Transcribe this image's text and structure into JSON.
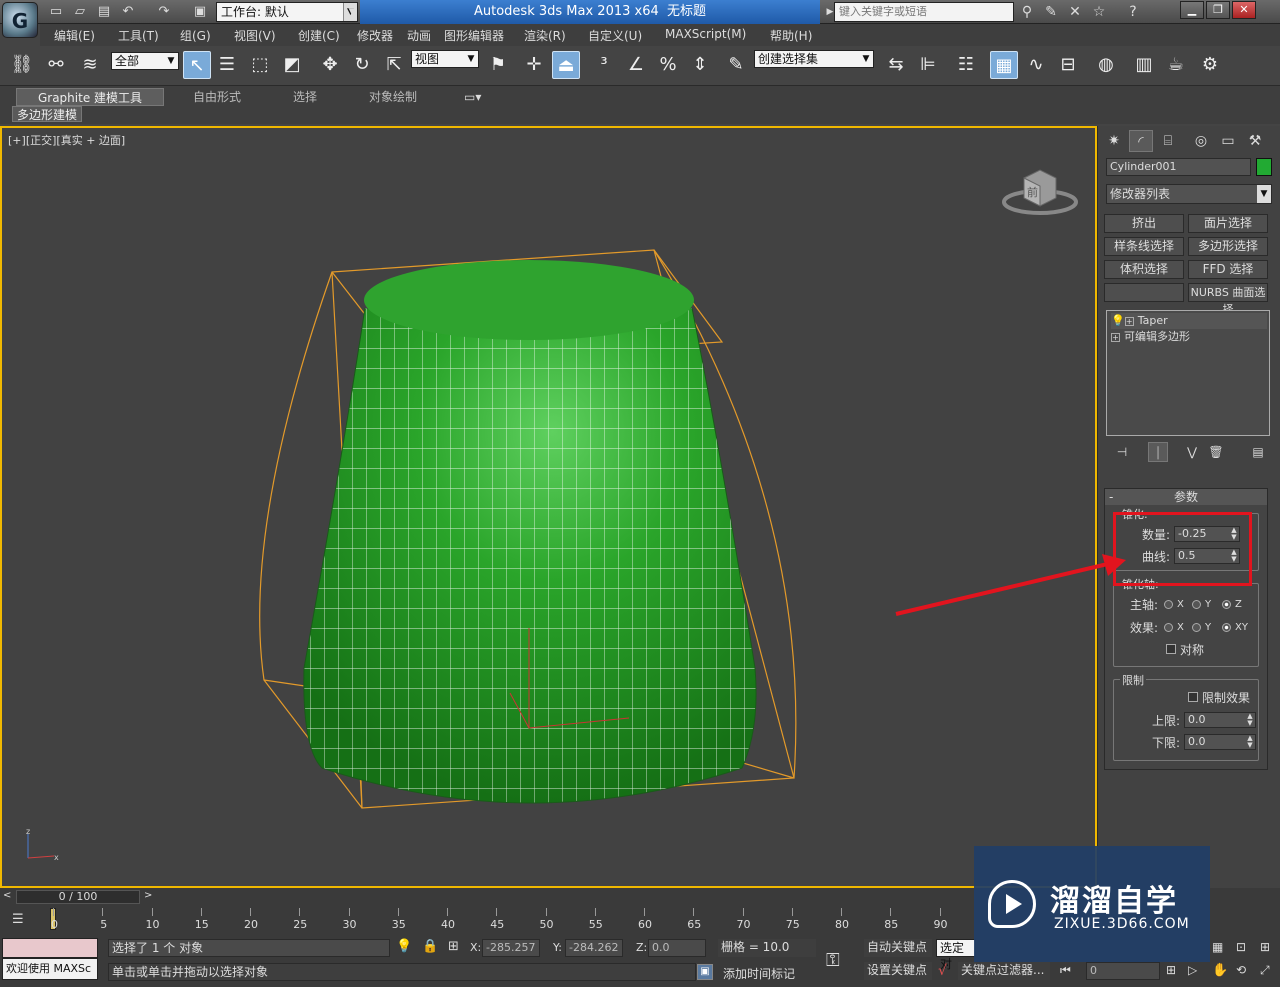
{
  "titlebar": {
    "workspace": "工作台: 默认",
    "app_name": "Autodesk 3ds Max  2013 x64",
    "doc_name": "无标题",
    "search_placeholder": "键入关键字或短语",
    "logo_letter": "G"
  },
  "menu": [
    "编辑(E)",
    "工具(T)",
    "组(G)",
    "视图(V)",
    "创建(C)",
    "修改器",
    "动画",
    "图形编辑器",
    "渲染(R)",
    "自定义(U)",
    "MAXScript(M)",
    "帮助(H)"
  ],
  "toolbar": {
    "selection_filter": "全部",
    "ref_coord": "视图",
    "named_selection": "创建选择集"
  },
  "ribbon": {
    "tabs": [
      "Graphite 建模工具",
      "自由形式",
      "选择",
      "对象绘制"
    ],
    "subtab": "多边形建模"
  },
  "viewport": {
    "label_parts": [
      "[+]",
      "[正交]",
      "[真实 + 边面]"
    ],
    "viewcube_face": "前"
  },
  "command_panel": {
    "object_name": "Cylinder001",
    "object_color": "#22aa33",
    "modifier_list": "修改器列表",
    "modifier_buttons": [
      "挤出",
      "面片选择",
      "样条线选择",
      "多边形选择",
      "体积选择",
      "FFD 选择",
      "",
      "NURBS 曲面选择"
    ],
    "stack": [
      "Taper",
      "可编辑多边形"
    ],
    "rollout_title": "参数",
    "taper": {
      "group_label": "锥化:",
      "amount_label": "数量:",
      "amount_value": "-0.25",
      "curve_label": "曲线:",
      "curve_value": "0.5"
    },
    "taper_axis": {
      "group_label": "锥化轴:",
      "primary_label": "主轴:",
      "primary_options": [
        "X",
        "Y",
        "Z"
      ],
      "primary_selected": "Z",
      "effect_label": "效果:",
      "effect_options": [
        "X",
        "Y",
        "XY"
      ],
      "effect_selected": "XY",
      "symmetry_label": "对称"
    },
    "limits": {
      "group_label": "限制",
      "limit_effect_label": "限制效果",
      "upper_label": "上限:",
      "upper_value": "0.0",
      "lower_label": "下限:",
      "lower_value": "0.0"
    }
  },
  "timeline": {
    "frame_display": "0 / 100",
    "ticks": [
      0,
      5,
      10,
      15,
      20,
      25,
      30,
      35,
      40,
      45,
      50,
      55,
      60,
      65,
      70,
      75,
      80,
      85,
      90
    ]
  },
  "statusbar": {
    "selection_status": "选择了 1 个 对象",
    "prompt": "单击或单击并拖动以选择对象",
    "welcome": "欢迎使用 MAXSc",
    "x_label": "X:",
    "x_value": "-285.257",
    "y_label": "Y:",
    "y_value": "-284.262",
    "z_label": "Z:",
    "z_value": "0.0",
    "grid": "栅格 = 10.0",
    "auto_key": "自动关键点",
    "set_key": "设置关键点",
    "selected_dropdown": "选定对",
    "add_time_tag": "添加时间标记",
    "key_filters": "关键点过滤器...",
    "frame_value": "0"
  },
  "watermark": {
    "title": "溜溜自学",
    "url": "ZIXUE.3D66.COM"
  },
  "colors": {
    "accent_title": "#1f5aa8",
    "viewport_border": "#f0b800",
    "highlight": "#e2141e",
    "mesh_green": "#2ea02e"
  }
}
